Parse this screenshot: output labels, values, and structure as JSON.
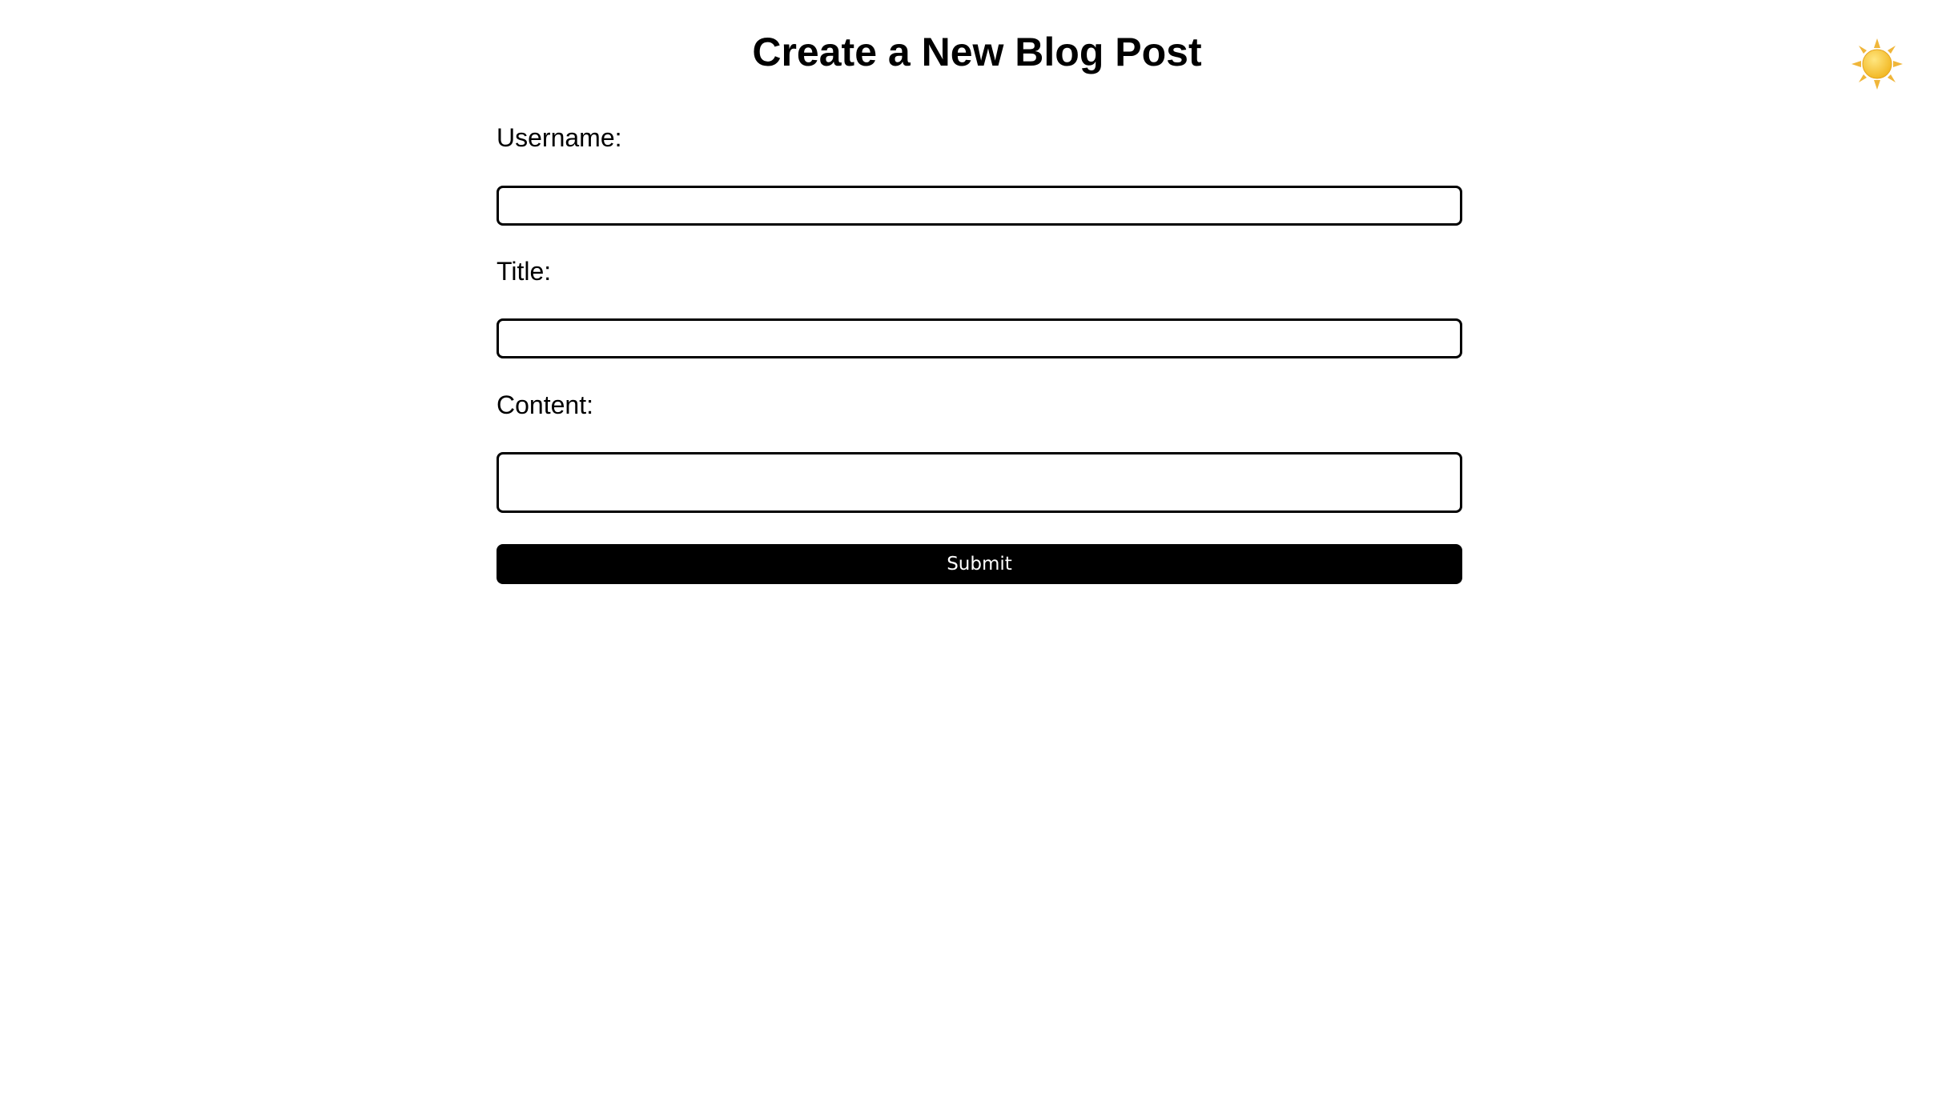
{
  "header": {
    "title": "Create a New Blog Post",
    "theme_toggle_icon": "sun-icon"
  },
  "form": {
    "username": {
      "label": "Username:",
      "value": "",
      "placeholder": ""
    },
    "title": {
      "label": "Title:",
      "value": "",
      "placeholder": ""
    },
    "content": {
      "label": "Content:",
      "value": "",
      "placeholder": ""
    },
    "submit_label": "Submit"
  },
  "colors": {
    "background": "#ffffff",
    "text": "#000000",
    "button_background": "#000000",
    "button_text": "#ffffff",
    "sun_core": "#f6c93a",
    "sun_rays": "#f0b63a"
  }
}
